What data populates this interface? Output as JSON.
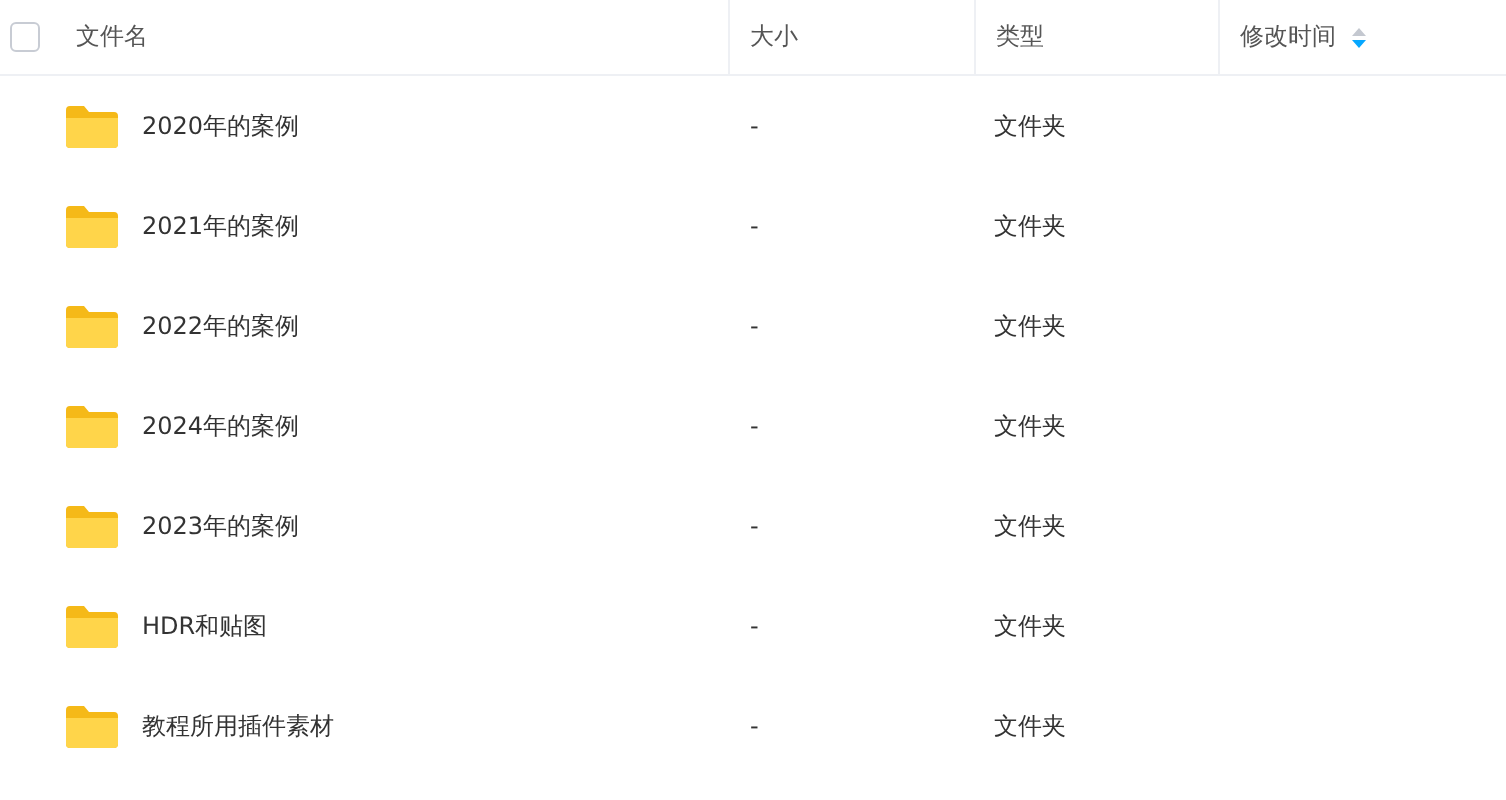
{
  "table": {
    "select_all": {
      "checked": false
    },
    "columns": [
      {
        "label": "文件名",
        "sorted": false
      },
      {
        "label": "大小",
        "sorted": false
      },
      {
        "label": "类型",
        "sorted": false
      },
      {
        "label": "修改时间",
        "sorted": true
      }
    ],
    "rows": [
      {
        "name": "2020年的案例",
        "size": "-",
        "type": "文件夹"
      },
      {
        "name": "2021年的案例",
        "size": "-",
        "type": "文件夹"
      },
      {
        "name": "2022年的案例",
        "size": "-",
        "type": "文件夹"
      },
      {
        "name": "2024年的案例",
        "size": "-",
        "type": "文件夹"
      },
      {
        "name": "2023年的案例",
        "size": "-",
        "type": "文件夹"
      },
      {
        "name": "HDR和贴图",
        "size": "-",
        "type": "文件夹"
      },
      {
        "name": "教程所用插件素材",
        "size": "-",
        "type": "文件夹"
      }
    ]
  }
}
